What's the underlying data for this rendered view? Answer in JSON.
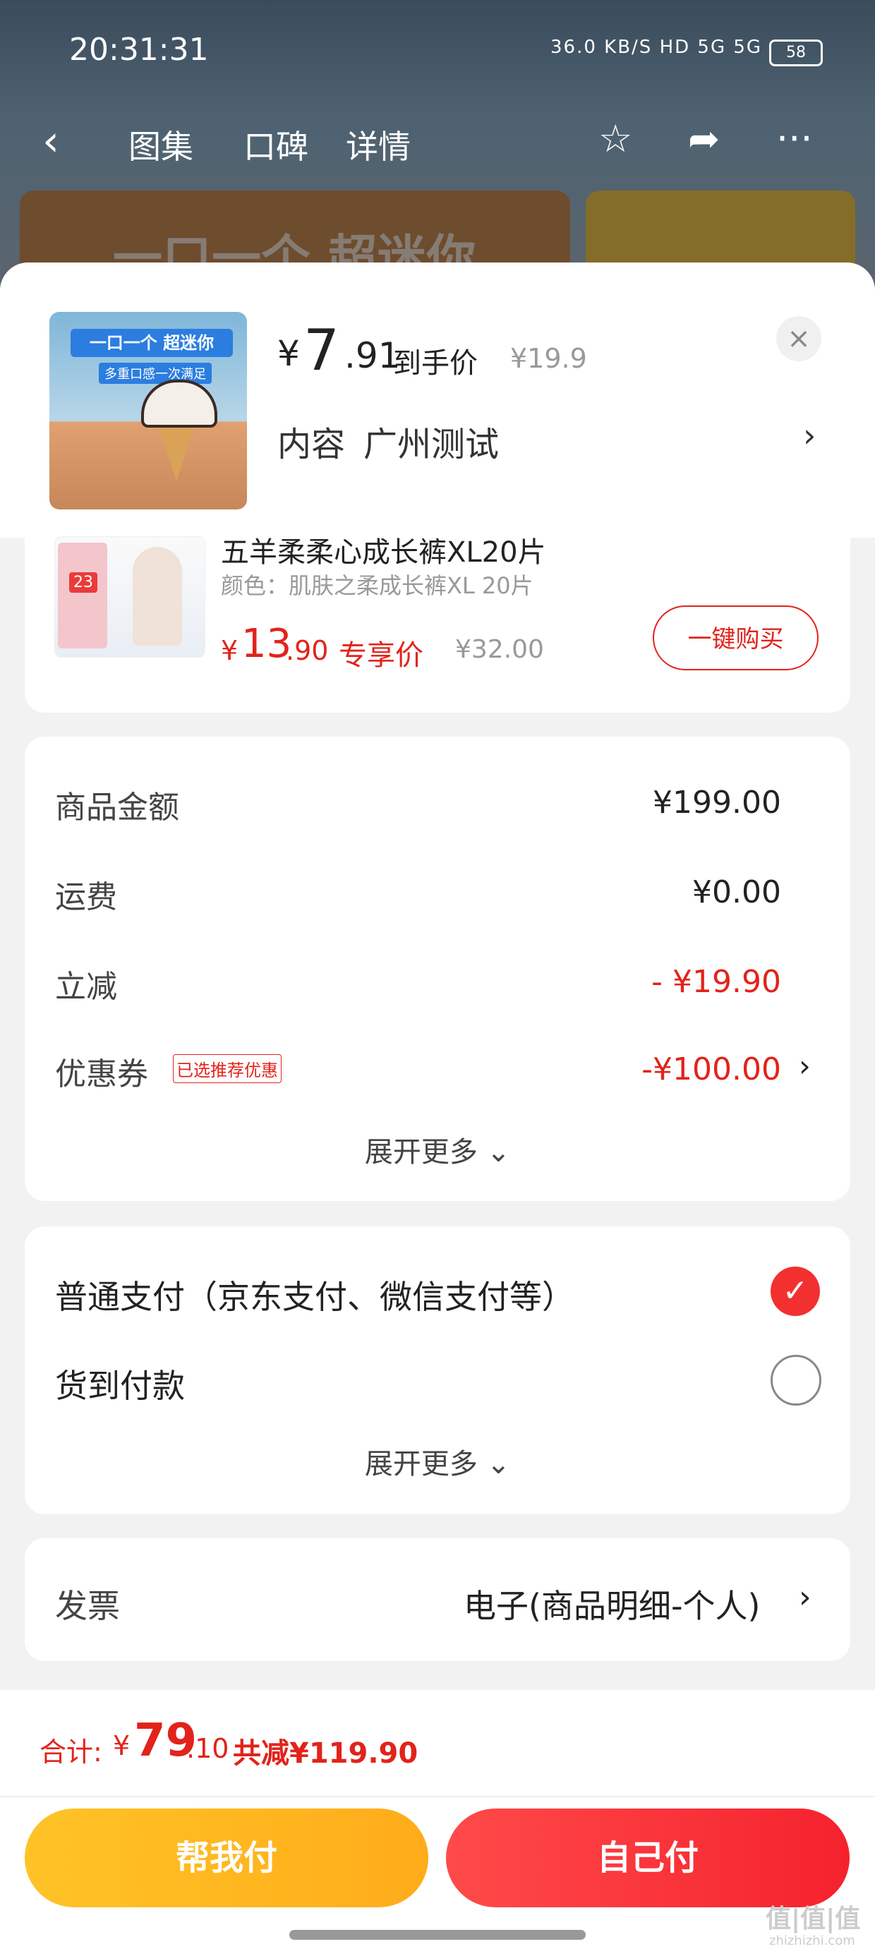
{
  "status_bar": {
    "time": "20:31:31",
    "network": "36.0 KB/S  HD  5G  5G",
    "battery": "58"
  },
  "nav": {
    "tabs": [
      "图集",
      "口碑",
      "详情"
    ],
    "banner_text": "一口一个 超迷你"
  },
  "header": {
    "thumb_title": "一口一个 超迷你",
    "thumb_sub": "多重口感一次满足",
    "price_currency": "¥",
    "price_int": "7",
    "price_dec": ".91",
    "price_tag": "到手价",
    "price_original": "¥19.9",
    "content_label": "内容",
    "content_value": "广州测试"
  },
  "product": {
    "title": "五羊柔柔心成长裤XL20片",
    "spec": "颜色：肌肤之柔成长裤XL 20片",
    "badge": "23",
    "price_currency": "¥",
    "price_int": "13",
    "price_dec": ".90",
    "price_tag": "专享价",
    "price_original": "¥32.00",
    "buy_button": "一键购买"
  },
  "summary": {
    "rows": [
      {
        "label": "商品金额",
        "value": "¥199.00"
      },
      {
        "label": "运费",
        "value": "¥0.00"
      },
      {
        "label": "立减",
        "value": "- ¥19.90"
      },
      {
        "label": "优惠券",
        "value": "-¥100.00",
        "tag": "已选推荐优惠"
      }
    ],
    "expand": "展开更多"
  },
  "payment": {
    "options": [
      {
        "label": "普通支付（京东支付、微信支付等）",
        "selected": true
      },
      {
        "label": "货到付款",
        "selected": false
      }
    ],
    "expand": "展开更多"
  },
  "invoice": {
    "label": "发票",
    "value": "电子(商品明细-个人)"
  },
  "footer": {
    "total_label": "合计:",
    "total_currency": "¥",
    "total_int": "79",
    "total_dec": ".10",
    "total_save": "共减¥119.90",
    "help_pay": "帮我付",
    "self_pay": "自己付"
  },
  "watermark": {
    "main": "值|值|值",
    "sub": "zhizhizhi.com"
  },
  "colors": {
    "accent_red": "#e2231a",
    "help_yellow": "#ffb51f",
    "self_red": "#f5222d"
  },
  "icons": [
    "back-icon",
    "star-icon",
    "share-icon",
    "more-icon",
    "close-icon",
    "chevron-right-icon",
    "check-icon",
    "chevron-down-icon"
  ]
}
